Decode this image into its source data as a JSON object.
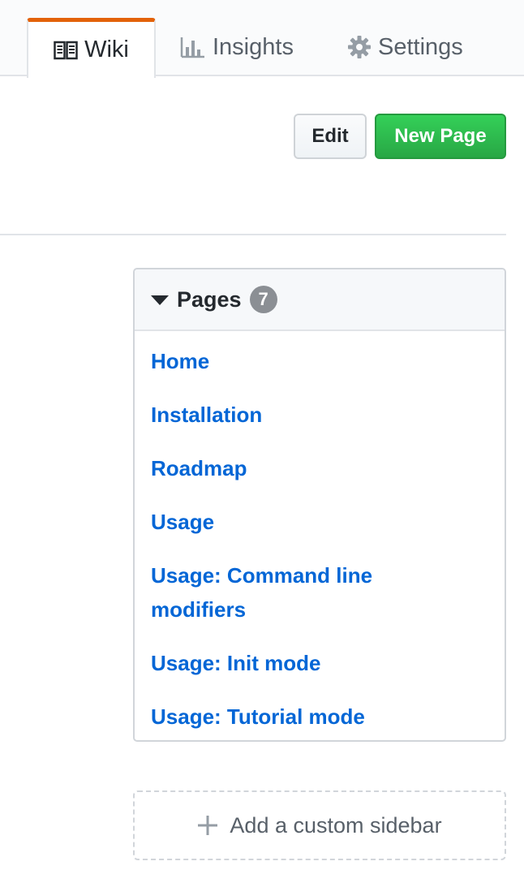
{
  "tabs": [
    {
      "label": "Wiki",
      "icon": "book-icon",
      "selected": true
    },
    {
      "label": "Insights",
      "icon": "graph-icon",
      "selected": false
    },
    {
      "label": "Settings",
      "icon": "gear-icon",
      "selected": false
    }
  ],
  "actions": {
    "edit_label": "Edit",
    "new_page_label": "New Page"
  },
  "pages": {
    "title": "Pages",
    "count": "7",
    "items": [
      "Home",
      "Installation",
      "Roadmap",
      "Usage",
      "Usage: Command line modifiers",
      "Usage: Init mode",
      "Usage: Tutorial mode"
    ]
  },
  "sidebar": {
    "add_label": "Add a custom sidebar"
  },
  "colors": {
    "accent_tab": "#e36209",
    "link": "#0366d6",
    "primary_button": "#28a745",
    "badge": "#8b8f94"
  }
}
